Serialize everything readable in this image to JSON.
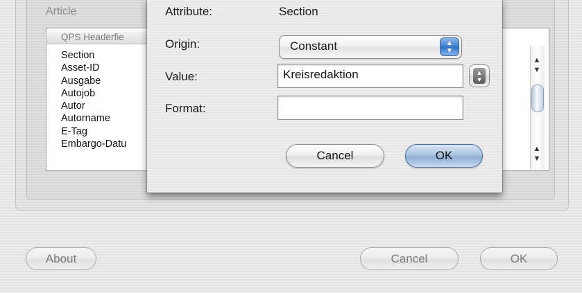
{
  "background_window": {
    "group_label": "Article",
    "list_header": "QPS Headerfie",
    "list_items": [
      "Section",
      "Asset-ID",
      "Ausgabe",
      "Autojob",
      "Autor",
      "Autorname",
      "E-Tag",
      "Embargo-Datu"
    ],
    "buttons": {
      "about": "About",
      "cancel": "Cancel",
      "ok": "OK"
    }
  },
  "dialog": {
    "attribute_label": "Attribute:",
    "attribute_value": "Section",
    "origin_label": "Origin:",
    "origin_value": "Constant",
    "value_label": "Value:",
    "value_text": "Kreisredaktion",
    "format_label": "Format:",
    "format_text": "",
    "cancel_button": "Cancel",
    "ok_button": "OK"
  },
  "icons": {
    "scroll_up": "▲",
    "scroll_down": "▼",
    "popup_up": "▲",
    "popup_down": "▼"
  }
}
